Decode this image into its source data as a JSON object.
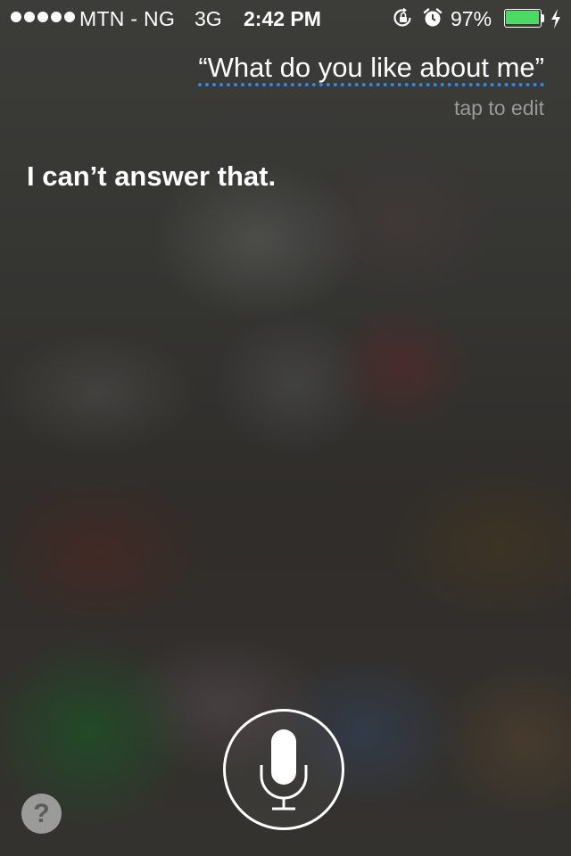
{
  "status_bar": {
    "signal_icon": "signal-dots-icon",
    "carrier": "MTN - NG",
    "network": "3G",
    "time": "2:42 PM",
    "rotation_lock_icon": "rotation-lock-icon",
    "alarm_icon": "alarm-clock-icon",
    "battery_percent": "97%",
    "battery_level": 0.97,
    "battery_color": "#4cd964",
    "charging_icon": "charging-bolt-icon"
  },
  "siri": {
    "query": "“What do you like about me”",
    "query_underline_color": "#2f86e8",
    "tap_to_edit": "tap to edit",
    "response": "I can’t answer that.",
    "mic_icon": "microphone-icon",
    "help_label": "?"
  }
}
